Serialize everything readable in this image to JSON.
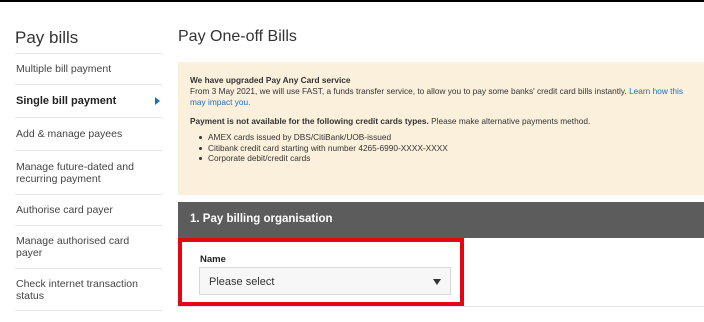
{
  "sidebar": {
    "title": "Pay bills",
    "items": [
      {
        "label": "Multiple bill payment"
      },
      {
        "label": "Single bill payment"
      },
      {
        "label": "Add & manage payees"
      },
      {
        "label": "Manage future-dated and recurring payment"
      },
      {
        "label": "Authorise card payer"
      },
      {
        "label": "Manage authorised card payer"
      },
      {
        "label": "Check internet transaction status"
      }
    ]
  },
  "main": {
    "title": "Pay One-off Bills",
    "notice": {
      "heading": "We have upgraded Pay Any Card service",
      "body": "From 3 May 2021, we will use FAST, a funds transfer service, to allow you to pay some banks' credit card bills instantly.",
      "link": "Learn how this may impact you.",
      "restriction_bold": "Payment is not available for the following credit cards types.",
      "restriction_text": "Please make alternative payments method.",
      "bullets": [
        "AMEX cards issued by DBS/CitiBank/UOB-issued",
        "Citibank credit card starting with number 4265-6990-XXXX-XXXX",
        "Corporate debit/credit cards"
      ]
    },
    "section": {
      "title": "1. Pay billing organisation"
    },
    "name_field": {
      "label": "Name",
      "value": "Please select"
    }
  },
  "colors": {
    "highlight_border": "#e30613",
    "notice_bg": "#fbf0dc",
    "section_header_bg": "#5c5c5c",
    "link": "#1a6fc9"
  },
  "icons": {
    "active_item_marker": "caret-right-icon",
    "select_caret": "chevron-down-icon"
  }
}
